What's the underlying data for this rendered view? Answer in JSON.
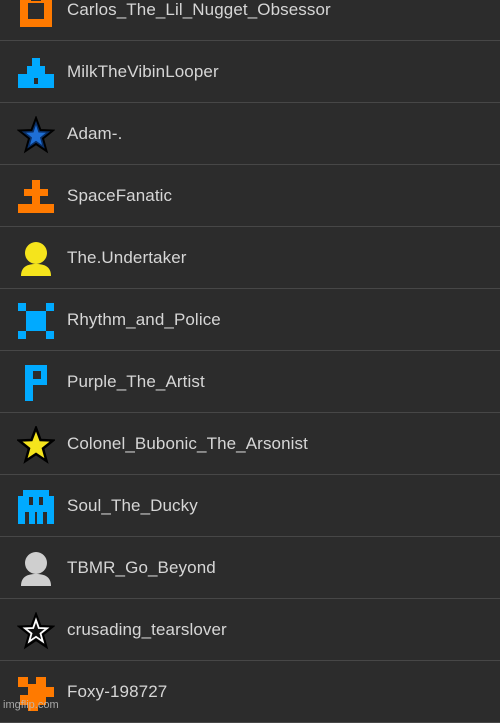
{
  "colors": {
    "background": "#2c2c2c",
    "divider": "#474747",
    "text": "#d6d6d6",
    "orange": "#ff7a00",
    "cyan": "#00aaff",
    "yellow": "#f5e41c",
    "gray": "#cfcfcf"
  },
  "users": [
    {
      "name": "Carlos_The_Lil_Nugget_Obsessor",
      "icon": "orange-cube-icon"
    },
    {
      "name": "MilkTheVibinLooper",
      "icon": "cyan-ship-icon"
    },
    {
      "name": "Adam-.",
      "icon": "blue-star-icon"
    },
    {
      "name": "SpaceFanatic",
      "icon": "orange-cross-icon"
    },
    {
      "name": "The.Undertaker",
      "icon": "yellow-person-icon"
    },
    {
      "name": "Rhythm_and_Police",
      "icon": "cyan-robot-icon"
    },
    {
      "name": "Purple_The_Artist",
      "icon": "cyan-p-icon"
    },
    {
      "name": "Colonel_Bubonic_The_Arsonist",
      "icon": "yellow-star-icon"
    },
    {
      "name": "Soul_The_Ducky",
      "icon": "cyan-invader-icon"
    },
    {
      "name": "TBMR_Go_Beyond",
      "icon": "gray-person-icon"
    },
    {
      "name": "crusading_tearslover",
      "icon": "white-star-icon"
    },
    {
      "name": "Foxy-198727",
      "icon": "orange-zigzag-icon"
    }
  ],
  "watermark": "imgflip.com"
}
